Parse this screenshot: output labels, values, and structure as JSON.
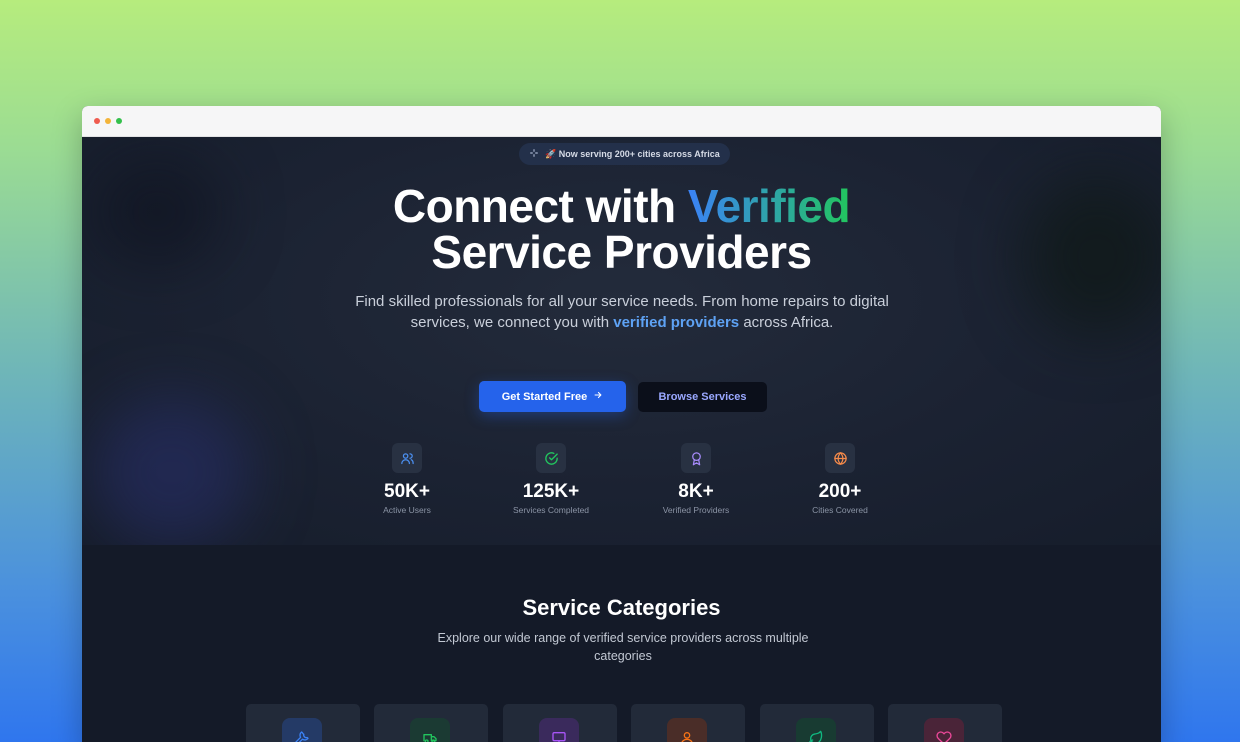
{
  "badge": {
    "text": "🚀 Now serving 200+ cities across Africa",
    "icon": "sparkles-icon"
  },
  "hero": {
    "title_part1": "Connect with",
    "title_highlight": "Verified",
    "title_part2": "Service Providers",
    "subtitle_part1": "Find skilled professionals for all your service needs. From home repairs to digital services, we connect you with",
    "subtitle_highlight": "verified providers",
    "subtitle_part2": "across Africa."
  },
  "buttons": {
    "primary_label": "Get Started Free",
    "secondary_label": "Browse Services"
  },
  "stats": [
    {
      "value": "50K+",
      "label": "Active Users",
      "icon": "users-icon",
      "color": "#4b8ff0"
    },
    {
      "value": "125K+",
      "label": "Services Completed",
      "icon": "check-circle-icon",
      "color": "#22c55e"
    },
    {
      "value": "8K+",
      "label": "Verified Providers",
      "icon": "award-icon",
      "color": "#a78bfa"
    },
    {
      "value": "200+",
      "label": "Cities Covered",
      "icon": "globe-icon",
      "color": "#f58a4a"
    }
  ],
  "categories_section": {
    "title": "Service Categories",
    "subtitle": "Explore our wide range of verified service providers across multiple categories",
    "cards": [
      {
        "icon": "wrench-icon",
        "color": "#3b82f6",
        "bg": "#243a66"
      },
      {
        "icon": "truck-icon",
        "color": "#22c55e",
        "bg": "#1b3a33"
      },
      {
        "icon": "monitor-icon",
        "color": "#a855f7",
        "bg": "#3a2a5c"
      },
      {
        "icon": "user-icon",
        "color": "#f97316",
        "bg": "#4a2d28"
      },
      {
        "icon": "leaf-icon",
        "color": "#10b981",
        "bg": "#183b32"
      },
      {
        "icon": "heart-icon",
        "color": "#ec4899",
        "bg": "#4a2438"
      }
    ]
  }
}
